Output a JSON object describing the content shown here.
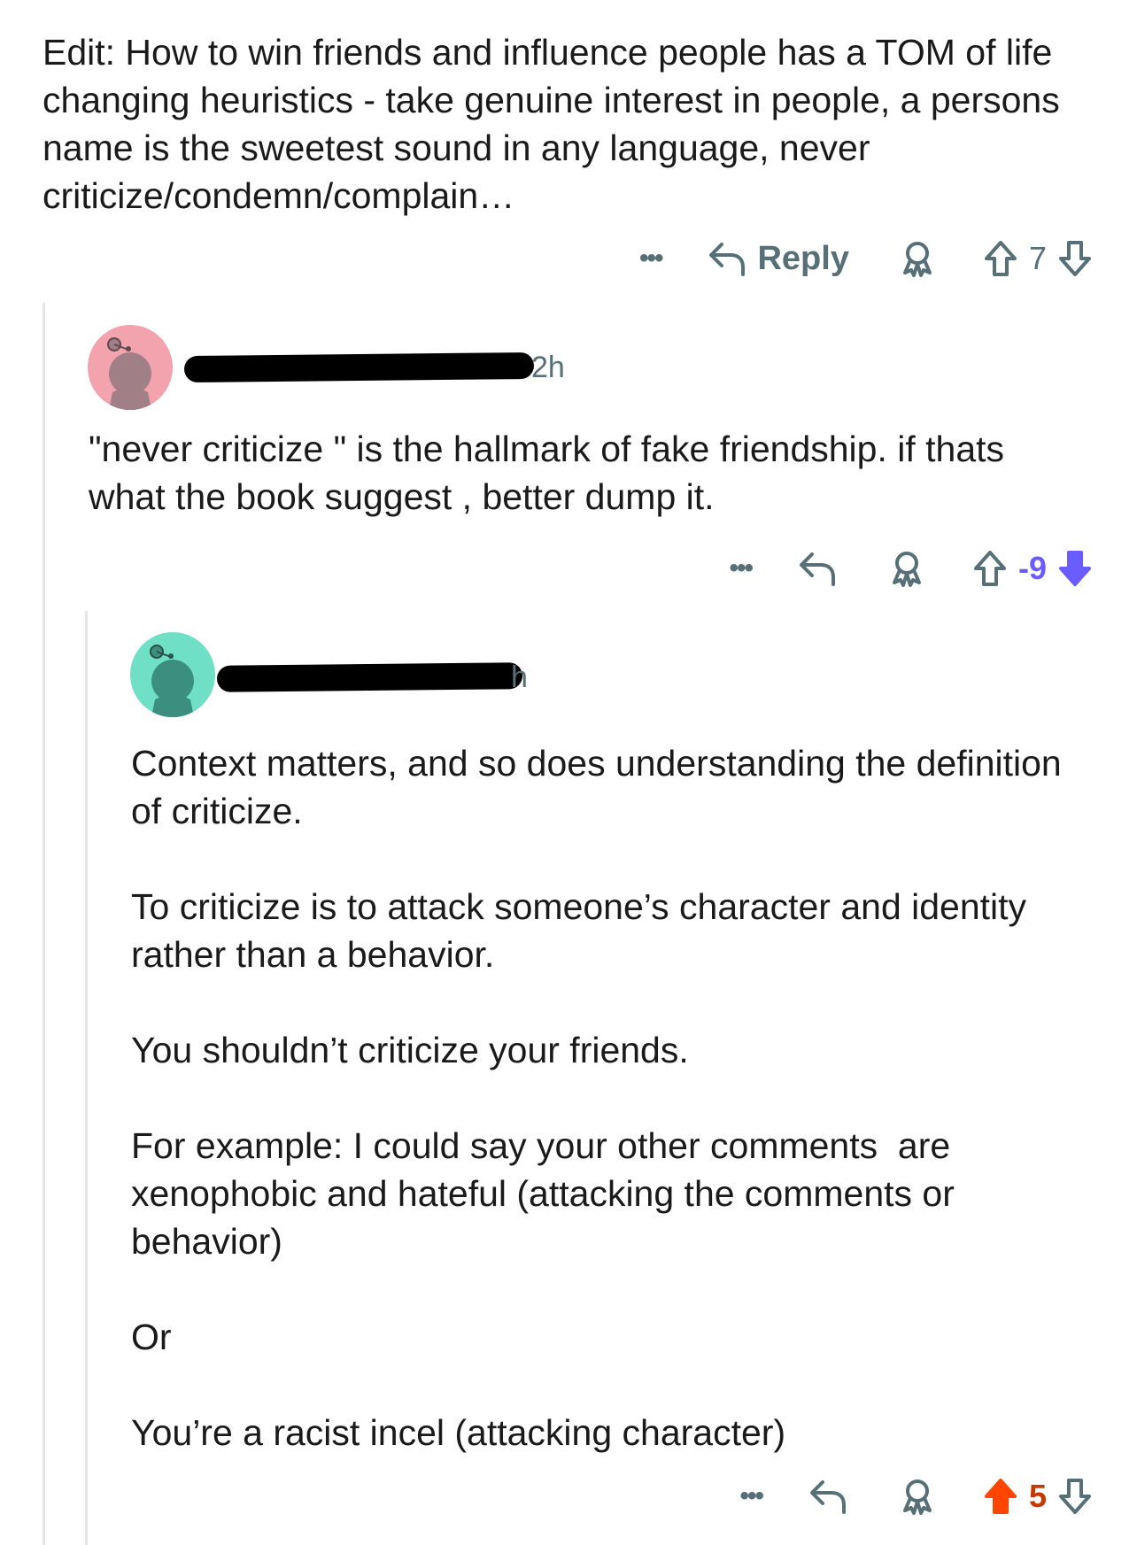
{
  "top_comment": {
    "text": "Edit: How to win friends and influence people has a TOM of life changing heuristics - take genuine interest in people, a persons name is the sweetest sound in any language, never criticize/condemn/complain…",
    "actions": {
      "more_label": "•••",
      "reply_label": "Reply",
      "score": "7"
    }
  },
  "reply_1": {
    "time_partial": "2h",
    "text": "\"never criticize \" is the hallmark of fake friendship. if thats what the book suggest , better dump it.",
    "actions": {
      "more_label": "•••",
      "score": "-9",
      "vote_state": "downvoted",
      "vote_color": "#6a5cff"
    }
  },
  "reply_2": {
    "time_partial": "h",
    "paragraphs": [
      "Context matters, and so does understanding the definition of criticize.",
      "To criticize is to attack someone’s character and identity rather than a behavior.",
      "You shouldn’t criticize your friends.",
      "For example: I could say your other comments  are xenophobic and hateful (attacking the comments or behavior)",
      "Or",
      "You’re a racist incel (attacking character)"
    ],
    "actions": {
      "more_label": "•••",
      "score": "5",
      "vote_state": "upvoted",
      "vote_color": "#ff4500"
    }
  },
  "colors": {
    "avatar_pink": "#f3a3ad",
    "avatar_teal": "#6fe0c6",
    "meta_gray": "#576f76",
    "thread_line": "#e4e6e8"
  },
  "icons": [
    "more-icon",
    "reply-icon",
    "award-icon",
    "upvote-icon",
    "downvote-icon",
    "snoo-avatar-icon"
  ]
}
